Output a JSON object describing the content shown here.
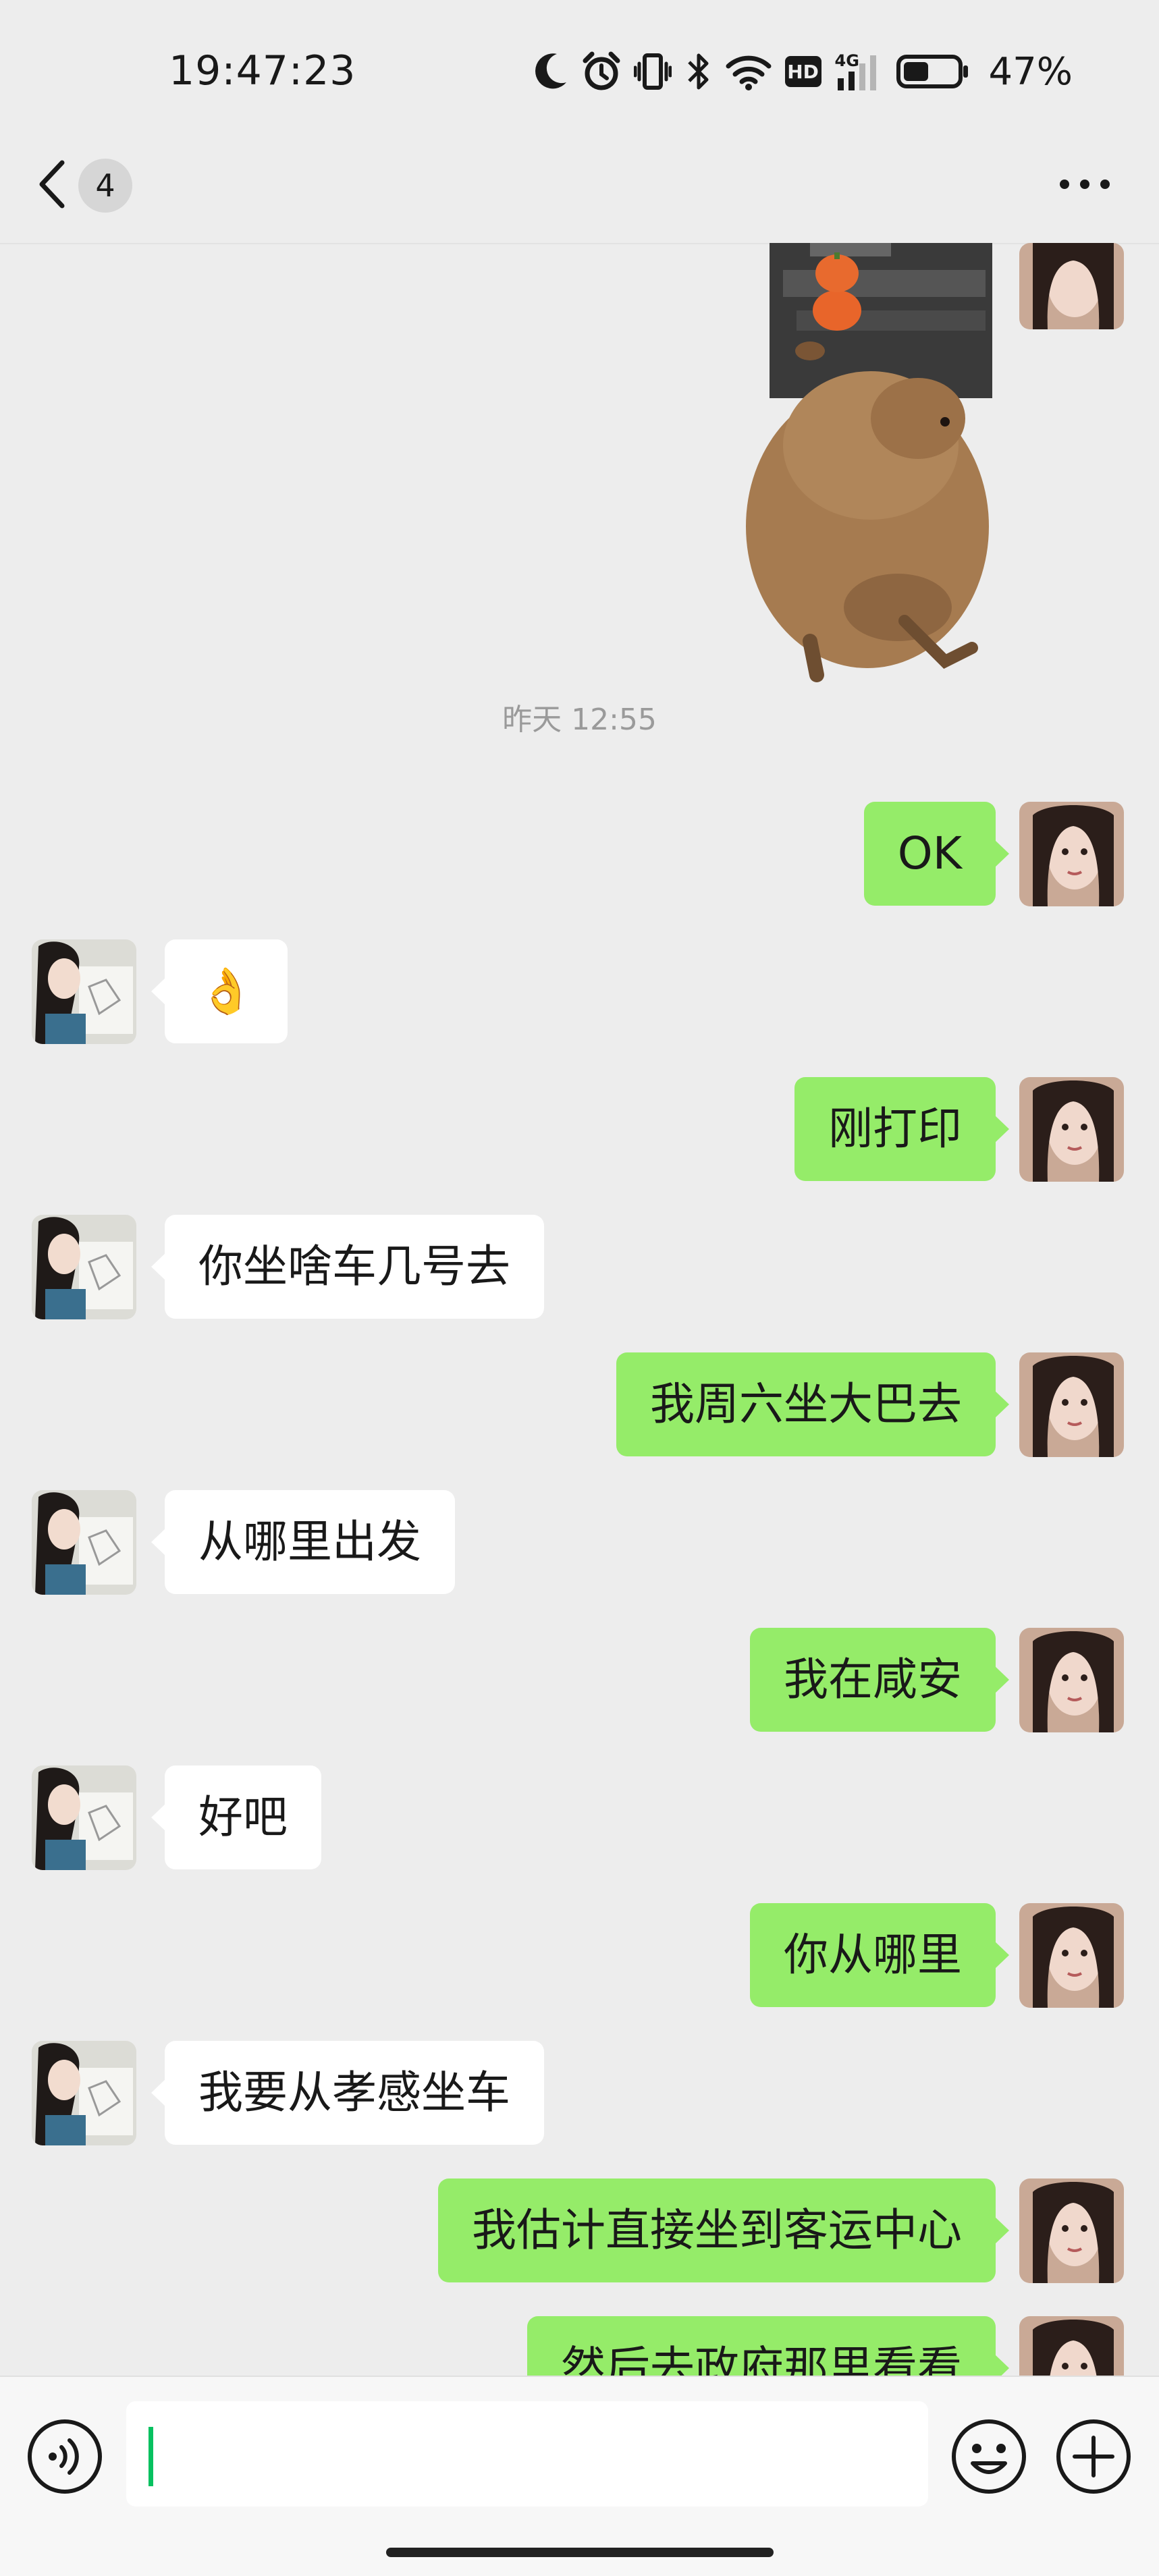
{
  "status_bar": {
    "time": "19:47:23",
    "battery_percent": "47%",
    "battery_level": 0.47,
    "icons": [
      "moon-icon",
      "alarm-icon",
      "vibrate-icon",
      "bluetooth-icon",
      "wifi-icon",
      "hd-icon",
      "signal-4g-icon",
      "battery-icon"
    ],
    "hd_label": "HD",
    "network_label": "4G"
  },
  "header": {
    "back_icon": "chevron-left-icon",
    "unread_count": "4",
    "more_icon": "more-dots-icon"
  },
  "chat": {
    "timestamp": "昨天 12:55",
    "sticker": "capybara-sticker",
    "messages": [
      {
        "from": "me",
        "text": "OK"
      },
      {
        "from": "them",
        "text": "👌"
      },
      {
        "from": "me",
        "text": "刚打印"
      },
      {
        "from": "them",
        "text": "你坐啥车几号去"
      },
      {
        "from": "me",
        "text": "我周六坐大巴去"
      },
      {
        "from": "them",
        "text": "从哪里出发"
      },
      {
        "from": "me",
        "text": "我在咸安"
      },
      {
        "from": "them",
        "text": "好吧"
      },
      {
        "from": "me",
        "text": "你从哪里"
      },
      {
        "from": "them",
        "text": "我要从孝感坐车"
      },
      {
        "from": "me",
        "text": "我估计直接坐到客运中心"
      },
      {
        "from": "me",
        "text": "然后去政府那里看看"
      }
    ]
  },
  "input_bar": {
    "voice_icon": "voice-icon",
    "text_value": "",
    "emoji_icon": "emoji-icon",
    "add_icon": "plus-circle-icon"
  },
  "colors": {
    "background": "#EDEDED",
    "my_bubble": "#95EC69",
    "their_bubble": "#FFFFFF",
    "accent": "#07C160"
  }
}
